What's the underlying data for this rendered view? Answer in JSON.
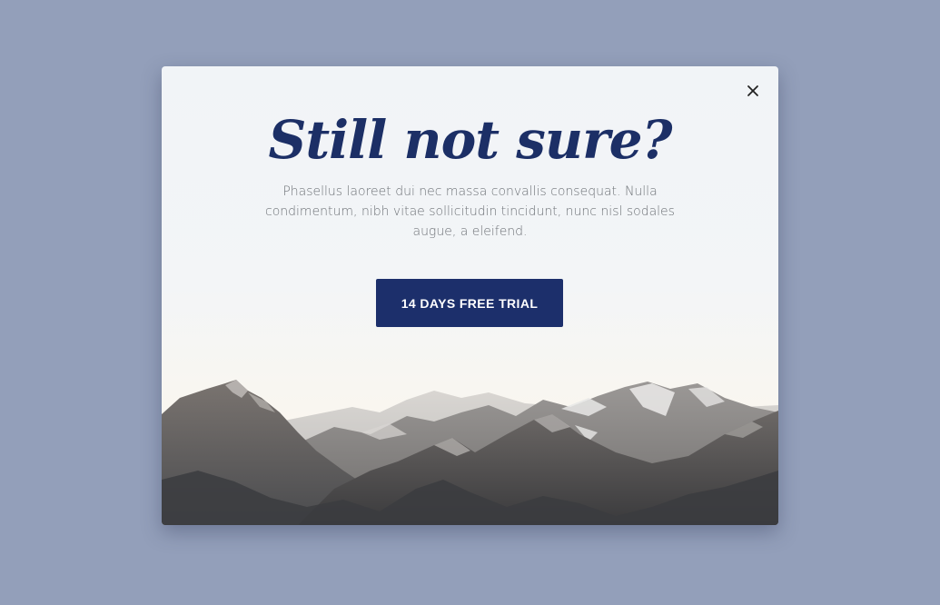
{
  "modal": {
    "title": "Still not sure?",
    "description": "Phasellus laoreet dui nec massa convallis consequat. Nulla condimentum, nibh vitae sollicitudin tincidunt, nunc nisl sodales augue, a eleifend.",
    "cta_label": "14 DAYS FREE TRIAL",
    "close_icon": "close-icon"
  },
  "colors": {
    "backdrop": "#939fba",
    "title": "#1c2f66",
    "button": "#1c2f6b",
    "button_text": "#ffffff",
    "body_text": "#6f7378"
  }
}
